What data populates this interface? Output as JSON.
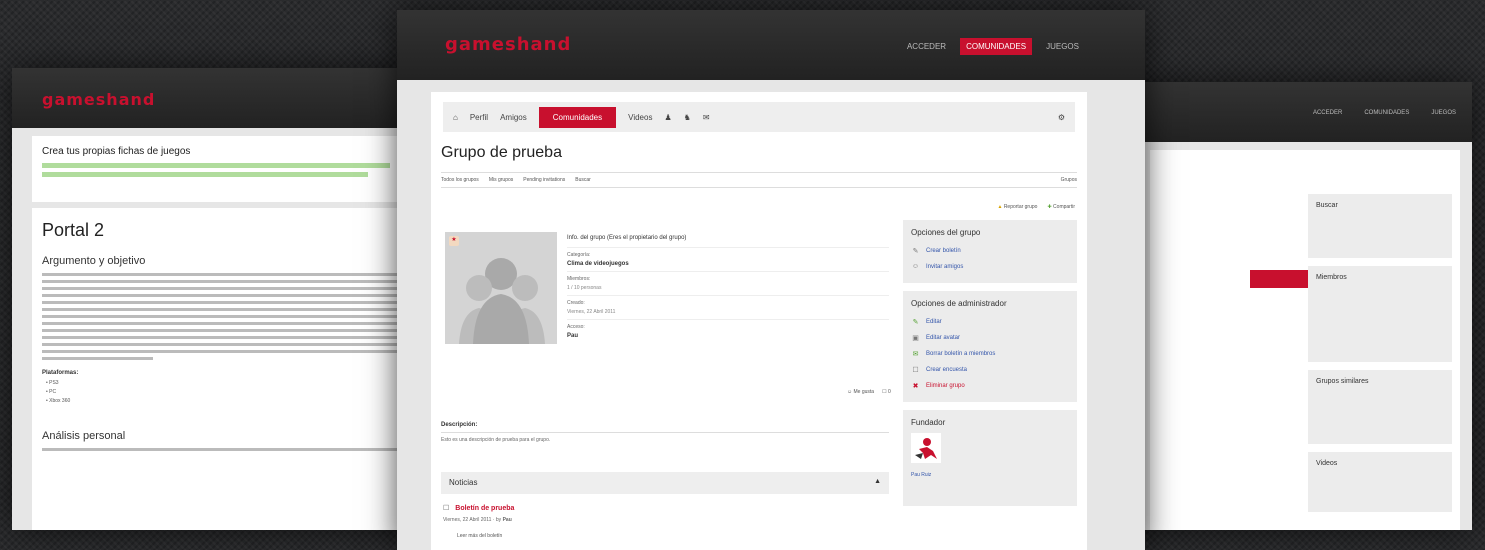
{
  "brand": "gameshand",
  "colors": {
    "accent": "#c8102e",
    "header_bg": "#262626",
    "panel_bg": "#ffffff",
    "sidebar_box": "#ececec"
  },
  "center": {
    "nav": [
      "ACCEDER",
      "COMUNIDADES",
      "JUEGOS"
    ],
    "tabs": {
      "perfil": "Perfil",
      "amigos": "Amigos",
      "active": "Comunidades",
      "videos": "Videos"
    },
    "group_title": "Grupo de prueba",
    "subnav": [
      "Todos los grupos",
      "Mis grupos",
      "Pending invitations",
      "Buscar"
    ],
    "subnav_right": "Grupos",
    "actions_top": [
      "Reportar grupo",
      "Compartir"
    ],
    "info": {
      "header": "Info. del grupo (Eres el propietario del grupo)",
      "category_label": "Categoría:",
      "category_value": "Clima de videojuegos",
      "members_label": "Miembros:",
      "members_value": "1 / 10 personas",
      "created_label": "Creado:",
      "created_value": "Viernes, 22 Abril 2011",
      "access_label": "Acceso:",
      "access_value": "Pau"
    },
    "small_actions": [
      "Me gusta",
      "0"
    ],
    "description_label": "Descripción:",
    "description_text": "Esto es una descripción de prueba para el grupo.",
    "news_title": "Noticias",
    "post_title": "Boletín de prueba",
    "post_meta": "Viernes, 22 Abril 2011 · by",
    "post_author": "Pau",
    "post_more": "Leer más del boletín",
    "group_options": {
      "title": "Opciones del grupo",
      "items": [
        "Crear boletín",
        "Invitar amigos"
      ]
    },
    "admin_options": {
      "title": "Opciones de administrador",
      "items": [
        "Editar",
        "Editar avatar",
        "Borrar boletín a miembros",
        "Crear encuesta",
        "Eliminar grupo"
      ]
    },
    "founder": {
      "title": "Fundador",
      "name": "Pau Ruiz"
    }
  },
  "left": {
    "notice_title": "Crea tus propias fichas de juegos",
    "article_title": "Portal 2",
    "section_argument": "Argumento y objetivo",
    "platforms_label": "Plataformas:",
    "platforms": [
      "PS3",
      "PC",
      "Xbox 360"
    ],
    "section_analysis": "Análisis personal"
  },
  "right": {
    "nav": [
      "ACCEDER",
      "COMUNIDADES",
      "JUEGOS"
    ],
    "boxes": [
      "Buscar",
      "Miembros",
      "Grupos similares",
      "Videos"
    ]
  }
}
